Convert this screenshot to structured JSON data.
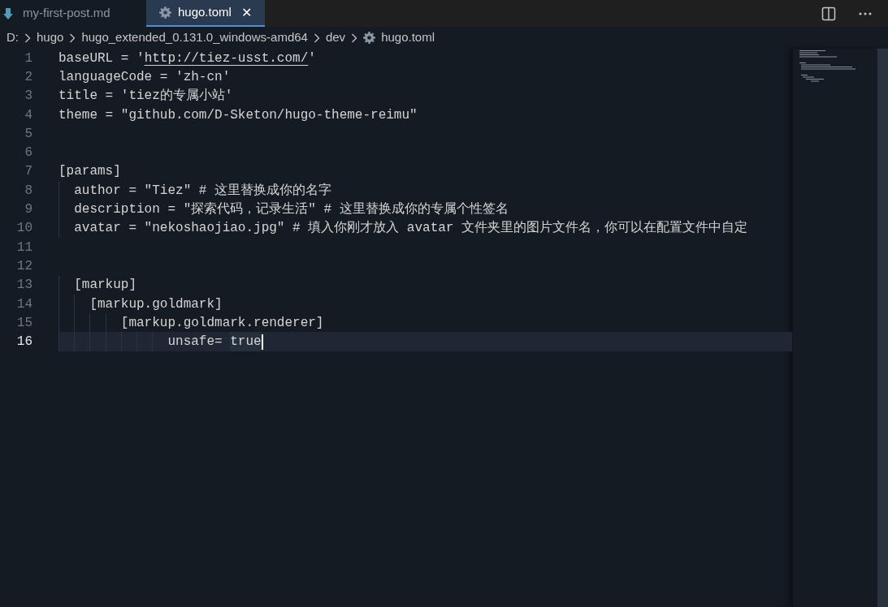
{
  "tabs": [
    {
      "label": "my-first-post.md",
      "kind": "markdown",
      "selected": false
    },
    {
      "label": "hugo.toml",
      "kind": "settings",
      "selected": true,
      "close": "✕"
    }
  ],
  "actions": [
    {
      "kind": "split"
    },
    {
      "kind": "more"
    }
  ],
  "breadcrumbs": [
    {
      "label": "D:"
    },
    {
      "label": "hugo"
    },
    {
      "label": "hugo_extended_0.131.0_windows-amd64"
    },
    {
      "label": "dev"
    },
    {
      "label": "hugo.toml",
      "kind": "settings"
    }
  ],
  "lines": [
    {
      "number": "1",
      "current": false,
      "segments": [
        {
          "text": "baseURL = '"
        },
        {
          "text": "http://tiez-usst.com/",
          "kind": "link"
        },
        {
          "text": "'"
        }
      ]
    },
    {
      "number": "2",
      "current": false,
      "segments": [
        {
          "text": "languageCode = 'zh-cn'"
        }
      ]
    },
    {
      "number": "3",
      "current": false,
      "segments": [
        {
          "text": "title = 'tiez的专属小站'"
        }
      ]
    },
    {
      "number": "4",
      "current": false,
      "segments": [
        {
          "text": "theme = \"github.com/D-Sketon/hugo-theme-reimu\""
        }
      ]
    },
    {
      "number": "5",
      "current": false
    },
    {
      "number": "6",
      "current": false
    },
    {
      "number": "7",
      "current": false,
      "segments": [
        {
          "text": "[params]"
        }
      ]
    },
    {
      "number": "8",
      "current": false,
      "segments": [
        {
          "text": "  author = \"Tiez\" # 这里替换成你的名字"
        }
      ]
    },
    {
      "number": "9",
      "current": false,
      "segments": [
        {
          "text": "  description = \"探索代码，记录生活\" # 这里替换成你的专属个性签名"
        }
      ]
    },
    {
      "number": "10",
      "current": false,
      "segments": [
        {
          "text": "  avatar = \"nekoshaojiao.jpg\" # 填入你刚才放入 avatar 文件夹里的图片文件名，你可以在配置文件中自定"
        }
      ]
    },
    {
      "number": "11",
      "current": false
    },
    {
      "number": "12",
      "current": false
    },
    {
      "number": "13",
      "current": false,
      "segments": [
        {
          "text": "  [markup]"
        }
      ]
    },
    {
      "number": "14",
      "current": false,
      "segments": [
        {
          "text": "    [markup.goldmark]"
        }
      ]
    },
    {
      "number": "15",
      "current": false,
      "segments": [
        {
          "text": "        [markup.goldmark.renderer]"
        }
      ]
    },
    {
      "number": "16",
      "current": true,
      "segments": [
        {
          "text": "              unsafe= "
        },
        {
          "text": "true",
          "kind": "highlight"
        }
      ]
    }
  ]
}
